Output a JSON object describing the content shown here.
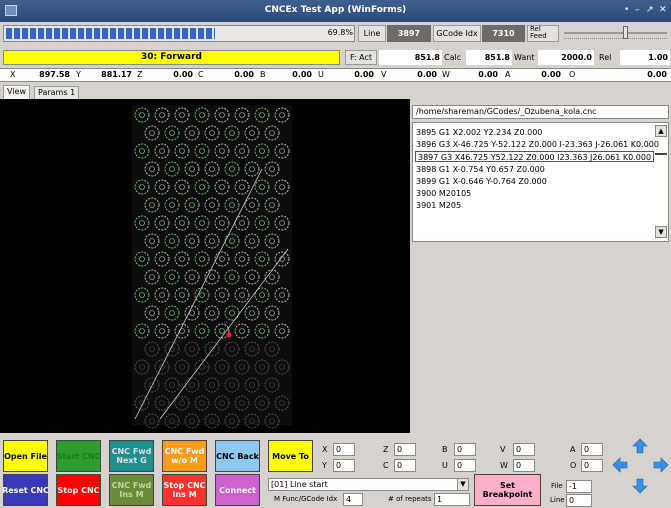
{
  "window": {
    "title": "CNCEx Test App (WinForms)",
    "controls": [
      "•",
      "–",
      "↗",
      "✕"
    ]
  },
  "progress": {
    "fraction": 0.698,
    "percent_label": "69.8%"
  },
  "row1": {
    "line_label": "Line",
    "line_value": "3897",
    "gcode_idx_label": "GCode Idx",
    "gcode_idx_value": "7310",
    "rel_feed_label": "Rel\nFeed",
    "rel_feed_fraction": 0.6
  },
  "row2": {
    "status": "30: Forward",
    "f_act_label": "F: Act",
    "f_act_value": "851.8",
    "calc_label": "Calc",
    "calc_value": "851.8",
    "want_label": "Want",
    "want_value": "2000.0",
    "rel_label": "Rel",
    "rel_value": "1.00"
  },
  "axes": [
    {
      "label": "X",
      "value": "897.58"
    },
    {
      "label": "Y",
      "value": "881.17"
    },
    {
      "label": "Z",
      "value": "0.00"
    },
    {
      "label": "C",
      "value": "0.00"
    },
    {
      "label": "B",
      "value": "0.00"
    },
    {
      "label": "U",
      "value": "0.00"
    },
    {
      "label": "V",
      "value": "0.00"
    },
    {
      "label": "W",
      "value": "0.00"
    },
    {
      "label": "A",
      "value": "0.00"
    },
    {
      "label": "O",
      "value": "0.00"
    }
  ],
  "tabs": [
    "View",
    "Params 1"
  ],
  "file_path": "/home/shareman/GCodes/_Ozubena_kola.cnc",
  "gcode_lines": [
    "3895 G1 X2.002 Y2.234 Z0.000",
    "3896 G3 X-46.725 Y-52.122 Z0.000 I-23.363 J-26.061 K0.000",
    "3897 G3 X46.725 Y52.122 Z0.000 I23.363 J26.061 K0.000",
    "3898 G1 X-0.754 Y0.657 Z0.000",
    "3899 G1 X-0.646 Y-0.764 Z0.000",
    "3900 M20105",
    "3901 M205"
  ],
  "selected_line_index": 2,
  "buttons": {
    "open_file": "Open File",
    "start_cnc": "Start CNC",
    "cnc_fwd_next_g": "CNC Fwd\nNext G",
    "cnc_fwd_wo_m": "CNC Fwd\nw/o M",
    "cnc_back": "CNC Back",
    "move_to": "Move To",
    "reset_cnc": "Reset CNC",
    "stop_cnc": "Stop CNC",
    "cnc_fwd_ins_m": "CNC Fwd\nIns M",
    "stop_cnc_ins_m": "Stop CNC\nIns M",
    "connect": "Connect",
    "set_breakpoint": "Set\nBreakpoint"
  },
  "coord_inputs": [
    {
      "label": "X",
      "value": "0"
    },
    {
      "label": "Z",
      "value": "0"
    },
    {
      "label": "B",
      "value": "0"
    },
    {
      "label": "V",
      "value": "0"
    },
    {
      "label": "A",
      "value": "0"
    },
    {
      "label": "Y",
      "value": "0"
    },
    {
      "label": "C",
      "value": "0"
    },
    {
      "label": "U",
      "value": "0"
    },
    {
      "label": "W",
      "value": "0"
    },
    {
      "label": "O",
      "value": "0"
    }
  ],
  "dropdown": {
    "selected": "[01] Line start"
  },
  "mfunc_label": "M Func/GCode Idx",
  "mfunc_value": "4",
  "repeats_label": "# of repeats",
  "repeats_value": "1",
  "file_label": "File",
  "file_value": "-1",
  "line_label2": "Line",
  "line_value2": "0",
  "colors": {
    "open_file": "#ffff00",
    "start_cnc": "#2e9b2e",
    "cnc_fwd_next_g": "#1f8f8f",
    "cnc_fwd_wo_m": "#ff9a1a",
    "cnc_back": "#8ec8f0",
    "move_to": "#ffff00",
    "reset_cnc": "#3a3ab8",
    "stop_cnc": "#ff0000",
    "cnc_fwd_ins_m": "#6b8a3a",
    "stop_cnc_ins_m": "#ff3030",
    "connect": "#d060d0",
    "set_breakpoint": "#ffb0c8",
    "arrow": "#3a8ee6"
  }
}
